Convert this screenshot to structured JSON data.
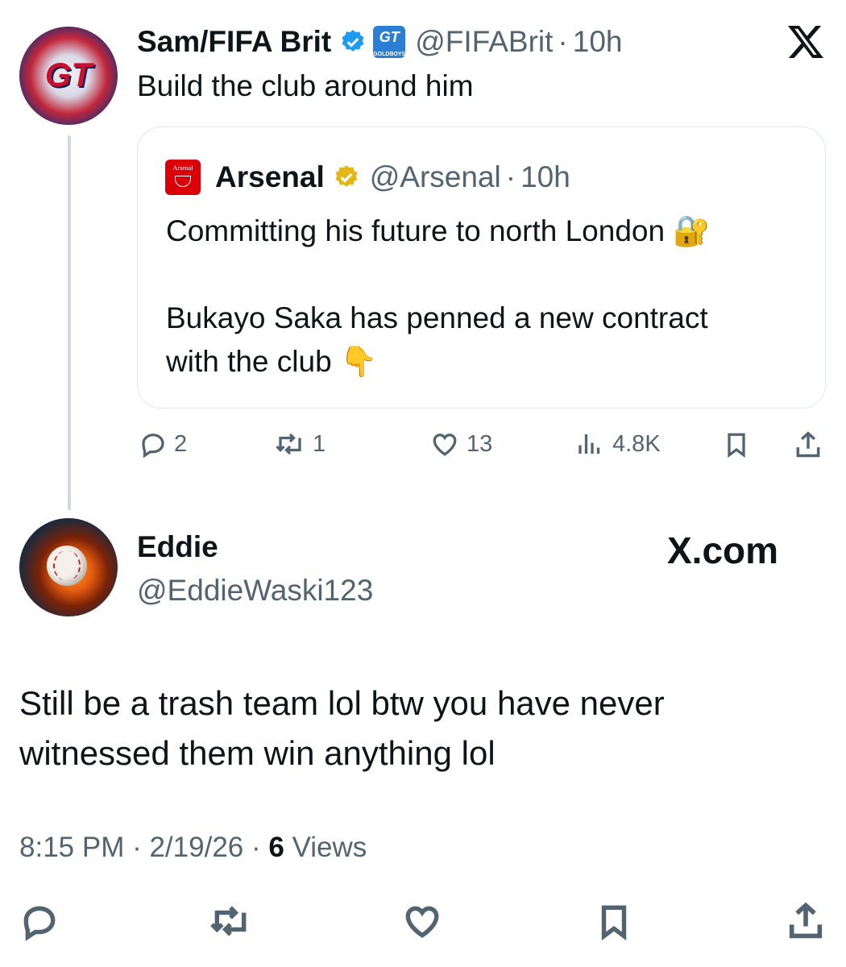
{
  "post": {
    "author_name": "Sam/FIFA Brit",
    "author_handle": "@FIFABrit",
    "time": "10h",
    "text": "Build the club around him",
    "badge_text": "GOLDBOYS",
    "avatar_text": "GT",
    "quote": {
      "author_name": "Arsenal",
      "author_handle": "@Arsenal",
      "time": "10h",
      "logo_text": "Arsenal",
      "line1": "Committing his future to north London 🔐",
      "line2": "Bukayo Saka has penned a new contract",
      "line3": "with the club 👇"
    },
    "stats": {
      "replies": "2",
      "reposts": "1",
      "likes": "13",
      "views": "4.8K"
    }
  },
  "reply": {
    "author_name": "Eddie",
    "author_handle": "@EddieWaski123",
    "brand": "X.com",
    "text_line1": "Still be a trash team lol btw you have never",
    "text_line2": "witnessed them win anything lol",
    "time": "8:15 PM",
    "date": "2/19/26",
    "views_count": "6",
    "views_label": "Views"
  },
  "colors": {
    "verified_blue": "#1d9bf0",
    "verified_gold": "#e2b719",
    "arsenal_red": "#db0007",
    "text_primary": "#0f1419",
    "text_secondary": "#536471",
    "border": "#e1e8ed"
  },
  "icons": {
    "x_logo": "x-logo-icon",
    "reply": "reply-icon",
    "repost": "repost-icon",
    "like": "heart-icon",
    "views": "views-icon",
    "bookmark": "bookmark-icon",
    "share": "share-icon"
  }
}
